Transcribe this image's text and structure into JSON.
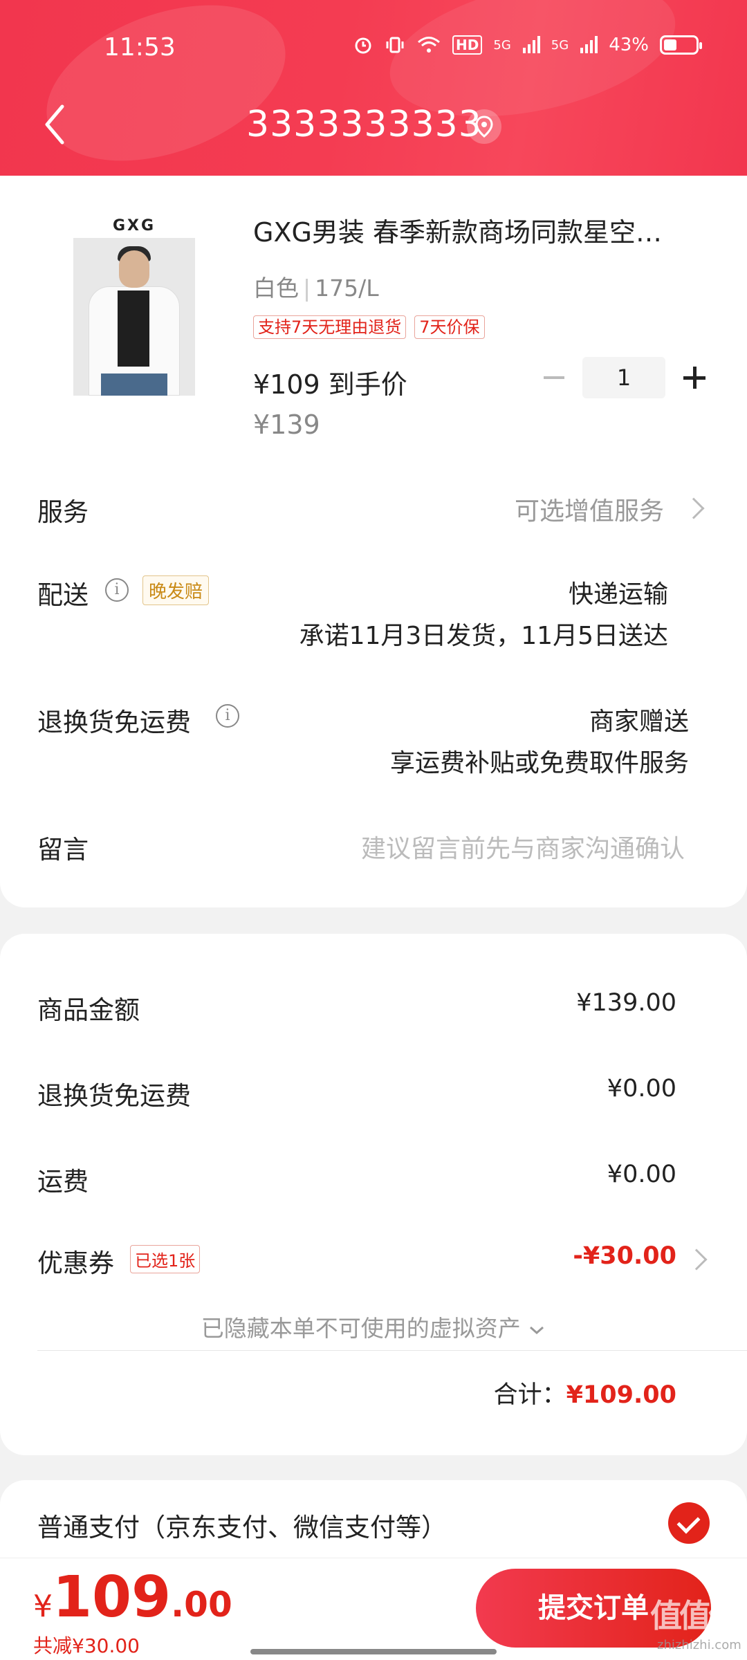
{
  "status_bar": {
    "time": "11:53",
    "network_hd": "HD",
    "sim1": "5G",
    "sim2": "5G",
    "battery": "43%"
  },
  "nav": {
    "title": "3333333333"
  },
  "product": {
    "brand": "GXG",
    "title": "GXG男装 春季新款商场同款星空…",
    "color": "白色",
    "size": "175/L",
    "tags": [
      "支持7天无理由退货",
      "7天价保"
    ],
    "price_now": "¥109 到手价",
    "price_original": "¥139",
    "quantity": "1"
  },
  "rows": {
    "service_label": "服务",
    "service_value": "可选增值服务",
    "delivery_label": "配送",
    "delivery_badge": "晚发赔",
    "delivery_method": "快递运输",
    "delivery_promise": "承诺11月3日发货，11月5日送达",
    "return_label": "退换货免运费",
    "return_value": "商家赠送",
    "return_desc": "享运费补贴或免费取件服务",
    "message_label": "留言",
    "message_placeholder": "建议留言前先与商家沟通确认"
  },
  "summary": {
    "goods_label": "商品金额",
    "goods_value": "¥139.00",
    "return_fee_label": "退换货免运费",
    "return_fee_value": "¥0.00",
    "shipping_label": "运费",
    "shipping_value": "¥0.00",
    "coupon_label": "优惠券",
    "coupon_badge": "已选1张",
    "coupon_value": "-¥30.00",
    "hidden_assets": "已隐藏本单不可使用的虚拟资产",
    "total_label": "合计：",
    "total_value": "¥109.00"
  },
  "payment": {
    "method": "普通支付（京东支付、微信支付等）"
  },
  "bottom": {
    "currency": "¥",
    "total_int": "109",
    "total_dec": ".00",
    "saved": "共减¥30.00",
    "submit": "提交订单"
  },
  "watermark": {
    "text": "值值值",
    "sub": "zhizhizhi.com"
  },
  "colors": {
    "brand_red": "#e2231a",
    "header_red": "#f43c52"
  }
}
